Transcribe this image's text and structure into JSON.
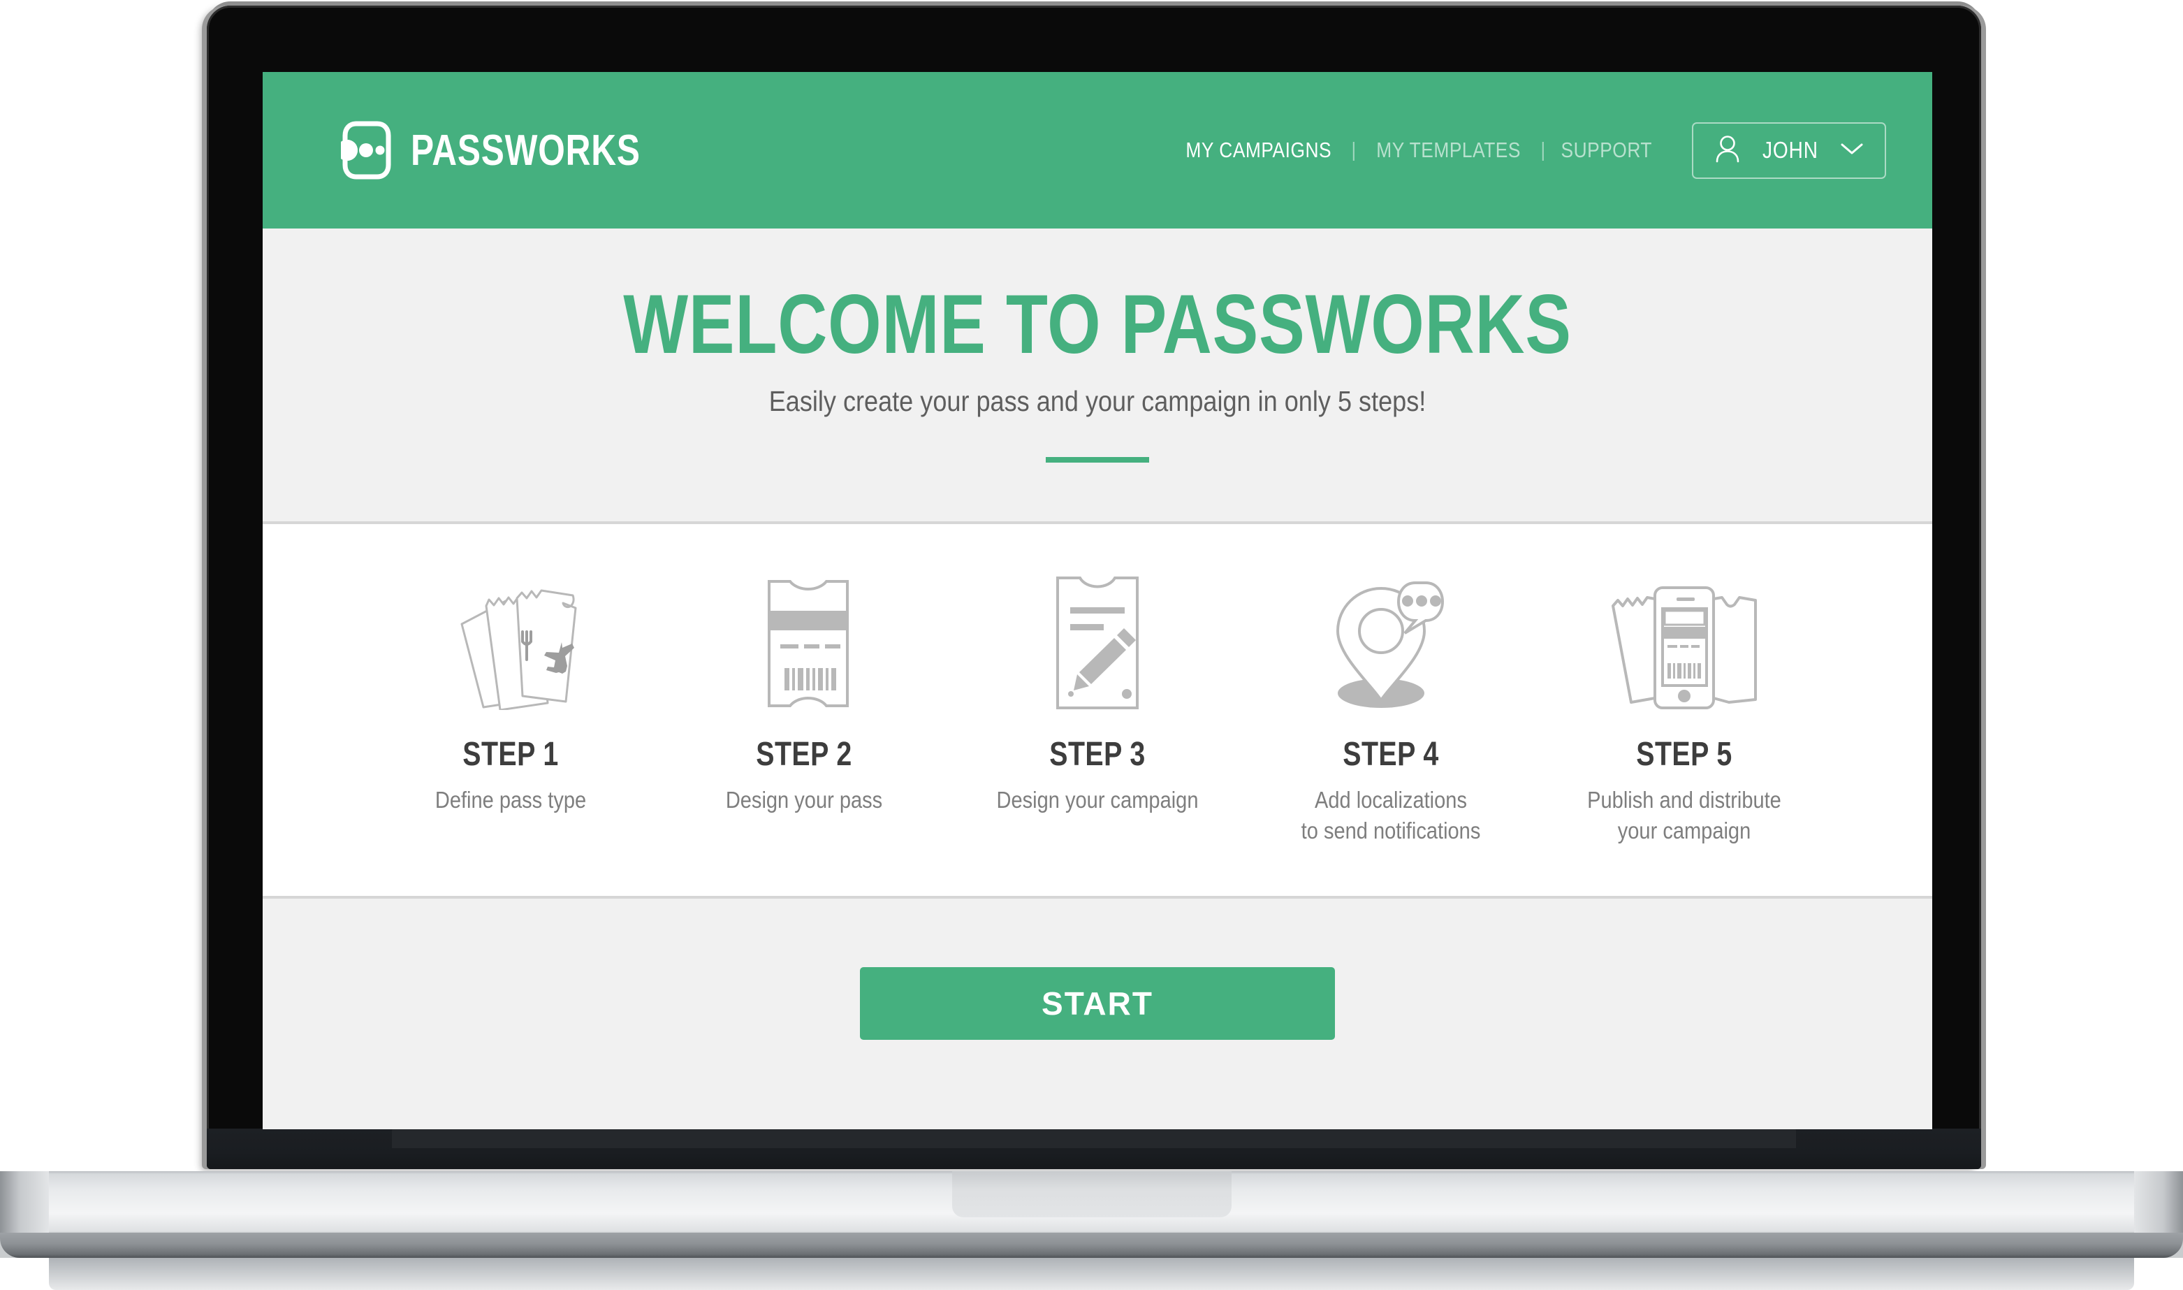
{
  "brand": {
    "name": "PASSWORKS",
    "logo_icon": "passworks-dots-logo-icon",
    "color": "#45b07f"
  },
  "header": {
    "background_color": "#45b07f",
    "nav": [
      {
        "label": "MY CAMPAIGNS",
        "active": true
      },
      {
        "label": "MY TEMPLATES",
        "active": false
      },
      {
        "label": "SUPPORT",
        "active": false
      }
    ],
    "separator": "|",
    "user_menu": {
      "name": "JOHN",
      "avatar_icon": "person-icon",
      "caret_icon": "chevron-down-icon"
    }
  },
  "hero": {
    "title": "WELCOME TO PASSWORKS",
    "subtitle": "Easily create your pass and your campaign in only 5 steps!",
    "title_color": "#45b07f",
    "background_color": "#f1f1f1",
    "rule_color": "#45b07f"
  },
  "steps": [
    {
      "title": "STEP 1",
      "description": "Define pass type",
      "icon": "tickets-fan-icon"
    },
    {
      "title": "STEP 2",
      "description": "Design your pass",
      "icon": "barcode-pass-icon"
    },
    {
      "title": "STEP 3",
      "description": "Design your campaign",
      "icon": "pencil-card-icon"
    },
    {
      "title": "STEP 4",
      "description": "Add localizations\nto send notifications",
      "icon": "map-pin-message-icon"
    },
    {
      "title": "STEP 5",
      "description": "Publish and distribute\nyour campaign",
      "icon": "phone-passes-icon"
    }
  ],
  "cta": {
    "start_label": "START",
    "button_color": "#45b07f",
    "background_color": "#f1f1f1"
  }
}
